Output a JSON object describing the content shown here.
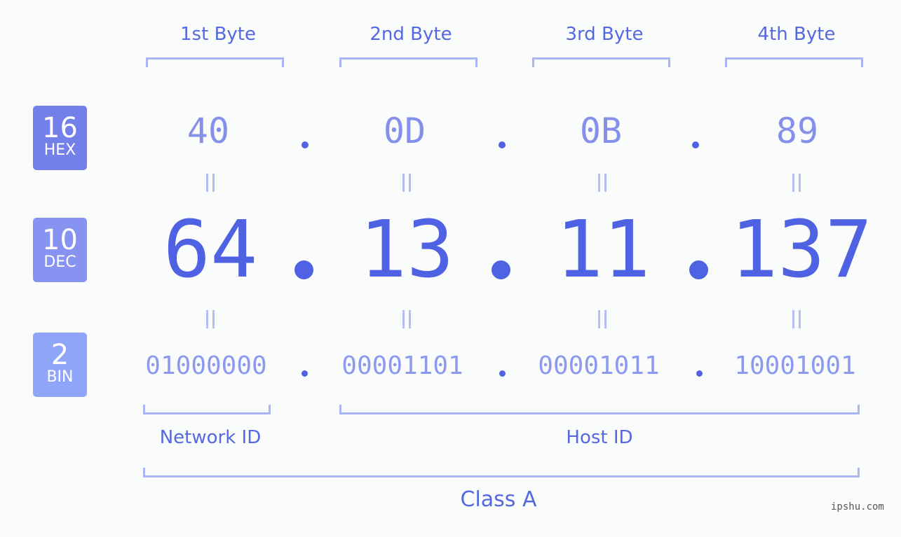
{
  "badges": [
    {
      "base": "16",
      "name": "HEX",
      "color": "#7480ea"
    },
    {
      "base": "10",
      "name": "DEC",
      "color": "#8693f0"
    },
    {
      "base": "2",
      "name": "BIN",
      "color": "#8fa5f8"
    }
  ],
  "byte_headers": [
    "1st Byte",
    "2nd Byte",
    "3rd Byte",
    "4th Byte"
  ],
  "hex": [
    "40",
    "0D",
    "0B",
    "89"
  ],
  "dec": [
    "64",
    "13",
    "11",
    "137"
  ],
  "bin": [
    "01000000",
    "00001101",
    "00001011",
    "10001001"
  ],
  "labels": {
    "network": "Network ID",
    "host": "Host ID",
    "class": "Class A"
  },
  "watermark": "ipshu.com"
}
